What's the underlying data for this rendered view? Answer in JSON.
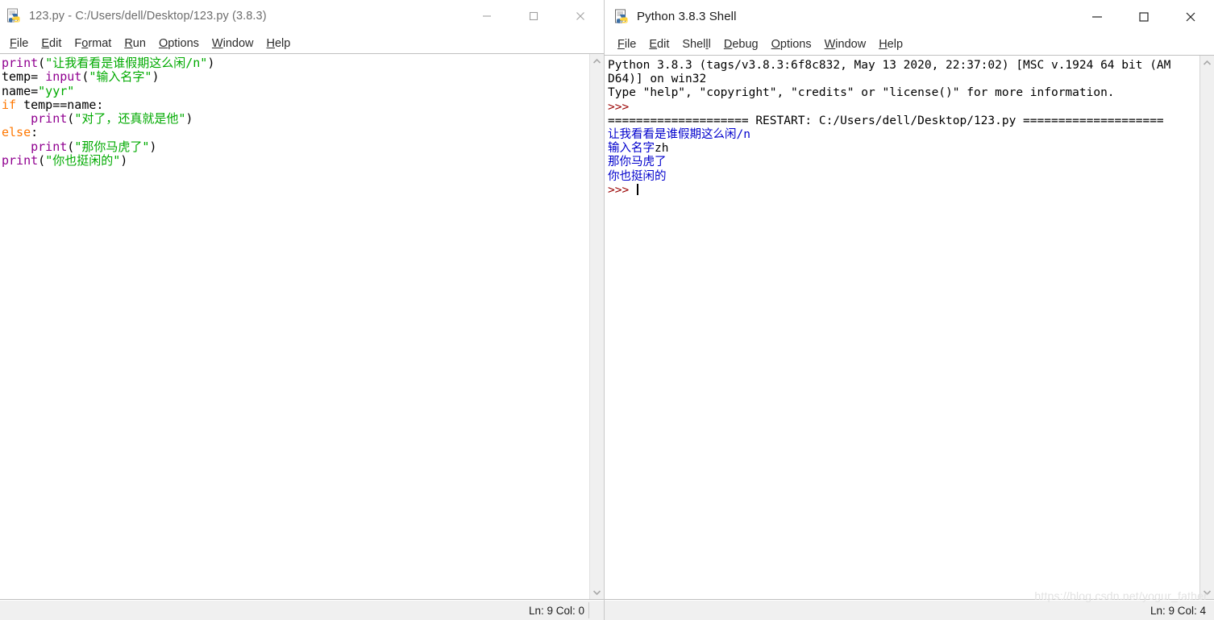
{
  "editor_window": {
    "title": "123.py - C:/Users/dell/Desktop/123.py (3.8.3)",
    "icon": "python-idle-icon",
    "controls": {
      "minimize": "minimize-icon",
      "maximize": "maximize-icon",
      "close": "close-icon"
    },
    "menu": [
      {
        "label": "File",
        "mnemonic": "F",
        "rest": "ile"
      },
      {
        "label": "Edit",
        "mnemonic": "E",
        "rest": "dit"
      },
      {
        "label": "Format",
        "mnemonic": "o",
        "pre": "F",
        "rest": "rmat"
      },
      {
        "label": "Run",
        "mnemonic": "R",
        "rest": "un"
      },
      {
        "label": "Options",
        "mnemonic": "O",
        "rest": "ptions"
      },
      {
        "label": "Window",
        "mnemonic": "W",
        "rest": "indow"
      },
      {
        "label": "Help",
        "mnemonic": "H",
        "rest": "elp"
      }
    ],
    "code_lines": [
      [
        {
          "t": "print",
          "c": "builtin"
        },
        {
          "t": "(",
          "c": "plain"
        },
        {
          "t": "\"让我看看是谁假期这么闲/n\"",
          "c": "str"
        },
        {
          "t": ")",
          "c": "plain"
        }
      ],
      [
        {
          "t": "temp= ",
          "c": "plain"
        },
        {
          "t": "input",
          "c": "builtin"
        },
        {
          "t": "(",
          "c": "plain"
        },
        {
          "t": "\"输入名字\"",
          "c": "str"
        },
        {
          "t": ")",
          "c": "plain"
        }
      ],
      [
        {
          "t": "name=",
          "c": "plain"
        },
        {
          "t": "\"yyr\"",
          "c": "str"
        }
      ],
      [
        {
          "t": "if",
          "c": "kw"
        },
        {
          "t": " temp==name:",
          "c": "plain"
        }
      ],
      [
        {
          "t": "    ",
          "c": "plain"
        },
        {
          "t": "print",
          "c": "builtin"
        },
        {
          "t": "(",
          "c": "plain"
        },
        {
          "t": "\"对了，还真就是他\"",
          "c": "str"
        },
        {
          "t": ")",
          "c": "plain"
        }
      ],
      [
        {
          "t": "else",
          "c": "kw"
        },
        {
          "t": ":",
          "c": "plain"
        }
      ],
      [
        {
          "t": "    ",
          "c": "plain"
        },
        {
          "t": "print",
          "c": "builtin"
        },
        {
          "t": "(",
          "c": "plain"
        },
        {
          "t": "\"那你马虎了\"",
          "c": "str"
        },
        {
          "t": ")",
          "c": "plain"
        }
      ],
      [
        {
          "t": "print",
          "c": "builtin"
        },
        {
          "t": "(",
          "c": "plain"
        },
        {
          "t": "\"你也挺闲的\"",
          "c": "str"
        },
        {
          "t": ")",
          "c": "plain"
        }
      ]
    ],
    "status": "Ln: 9  Col: 0"
  },
  "shell_window": {
    "title": "Python 3.8.3 Shell",
    "icon": "python-idle-icon",
    "controls": {
      "minimize": "minimize-icon",
      "maximize": "maximize-icon",
      "close": "close-icon"
    },
    "menu": [
      {
        "label": "File",
        "mnemonic": "F",
        "rest": "ile"
      },
      {
        "label": "Edit",
        "mnemonic": "E",
        "rest": "dit"
      },
      {
        "label": "Shell",
        "mnemonic": "l",
        "pre": "Shel",
        "rest": "l"
      },
      {
        "label": "Debug",
        "mnemonic": "D",
        "rest": "ebug"
      },
      {
        "label": "Options",
        "mnemonic": "O",
        "rest": "ptions"
      },
      {
        "label": "Window",
        "mnemonic": "W",
        "rest": "indow"
      },
      {
        "label": "Help",
        "mnemonic": "H",
        "rest": "elp"
      }
    ],
    "output_lines": [
      [
        {
          "t": "Python 3.8.3 (tags/v3.8.3:6f8c832, May 13 2020, 22:37:02) [MSC v.1924 64 bit (AM",
          "c": "plain"
        }
      ],
      [
        {
          "t": "D64)] on win32",
          "c": "plain"
        }
      ],
      [
        {
          "t": "Type \"help\", \"copyright\", \"credits\" or \"license()\" for more information.",
          "c": "plain"
        }
      ],
      [
        {
          "t": ">>>",
          "c": "prompt"
        }
      ],
      [
        {
          "t": "==================== RESTART: C:/Users/dell/Desktop/123.py ====================",
          "c": "restart"
        }
      ],
      [
        {
          "t": "让我看看是谁假期这么闲/n",
          "c": "stdout"
        }
      ],
      [
        {
          "t": "输入名字",
          "c": "stdout"
        },
        {
          "t": "zh",
          "c": "plain"
        }
      ],
      [
        {
          "t": "那你马虎了",
          "c": "stdout"
        }
      ],
      [
        {
          "t": "你也挺闲的",
          "c": "stdout"
        }
      ],
      [
        {
          "t": ">>> ",
          "c": "prompt"
        },
        {
          "t": "",
          "c": "caret"
        }
      ]
    ],
    "status": "Ln: 9  Col: 4",
    "watermark": "https://blog.csdn.net/yogur_father"
  },
  "colors": {
    "keyword": "#ff7700",
    "builtin": "#900090",
    "string": "#00aa00",
    "prompt": "#990000",
    "stdout": "#0000cc",
    "chrome": "#f0f0f0"
  }
}
